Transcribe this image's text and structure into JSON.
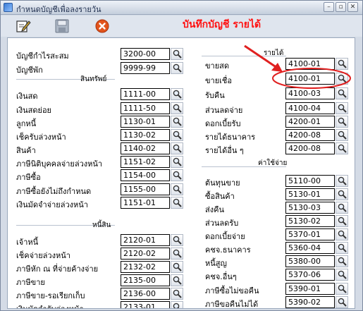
{
  "window": {
    "title": "กำหนดบัญชีเพื่อลงรายวัน"
  },
  "heading": "บันทึกบัญชี รายได้",
  "top_fields": [
    {
      "label": "บัญชีกำไรสะสม",
      "code": "3200-00"
    },
    {
      "label": "บัญชีพัก",
      "code": "9999-99"
    }
  ],
  "left_sections": [
    {
      "title": "สินทรัพย์",
      "rows": [
        {
          "label": "เงินสด",
          "code": "1111-00"
        },
        {
          "label": "เงินสดย่อย",
          "code": "1111-50"
        },
        {
          "label": "ลูกหนี้",
          "code": "1130-01"
        },
        {
          "label": "เช็ครับล่วงหน้า",
          "code": "1130-02"
        },
        {
          "label": "สินค้า",
          "code": "1140-02"
        },
        {
          "label": "ภาษีนิติบุคคลจ่ายล่วงหน้า",
          "code": "1151-02"
        },
        {
          "label": "ภาษีซื้อ",
          "code": "1154-00"
        },
        {
          "label": "ภาษีซื้อยังไม่ถึงกำหนด",
          "code": "1155-00"
        },
        {
          "label": "เงินมัดจำจ่ายล่วงหน้า",
          "code": "1151-01"
        }
      ]
    },
    {
      "title": "หนี้สิน",
      "rows": [
        {
          "label": "เจ้าหนี้",
          "code": "2120-01"
        },
        {
          "label": "เช็คจ่ายล่วงหน้า",
          "code": "2120-02"
        },
        {
          "label": "ภาษีหัก ณ ที่จ่ายค้างจ่าย",
          "code": "2132-02"
        },
        {
          "label": "ภาษีขาย",
          "code": "2135-00"
        },
        {
          "label": "ภาษีขาย-รอเรียกเก็บ",
          "code": "2136-00"
        },
        {
          "label": "เงินมัดจำรับล่วงหน้า",
          "code": "2133-01"
        }
      ]
    }
  ],
  "right_sections": [
    {
      "title": "รายได้",
      "rows": [
        {
          "label": "ขายสด",
          "code": "4100-01"
        },
        {
          "label": "ขายเชื่อ",
          "code": "4100-01"
        },
        {
          "label": "รับคืน",
          "code": "4100-03"
        },
        {
          "label": "ส่วนลดจ่าย",
          "code": "4100-04"
        },
        {
          "label": "ดอกเบี้ยรับ",
          "code": "4200-01"
        },
        {
          "label": "รายได้ธนาคาร",
          "code": "4200-08"
        },
        {
          "label": "รายได้อื่น ๆ",
          "code": "4200-08"
        }
      ]
    },
    {
      "title": "ค่าใช้จ่าย",
      "rows": [
        {
          "label": "ต้นทุนขาย",
          "code": "5110-00"
        },
        {
          "label": "ซื้อสินค้า",
          "code": "5130-01"
        },
        {
          "label": "ส่งคืน",
          "code": "5130-03"
        },
        {
          "label": "ส่วนลดรับ",
          "code": "5130-02"
        },
        {
          "label": "ดอกเบี้ยจ่าย",
          "code": "5370-01"
        },
        {
          "label": "คชจ.ธนาคาร",
          "code": "5360-04"
        },
        {
          "label": "หนี้สูญ",
          "code": "5380-00"
        },
        {
          "label": "คชจ.อื่นๆ",
          "code": "5370-06"
        },
        {
          "label": "ภาษีซื้อไม่ขอคืน",
          "code": "5390-01"
        },
        {
          "label": "ภาษีขอคืนไม่ได้",
          "code": "5390-02"
        }
      ]
    }
  ],
  "colors": {
    "heading": "#ff1111",
    "annotation": "#e02020"
  },
  "icons": {
    "edit": "edit-icon",
    "save": "save-icon",
    "cancel": "cancel-icon",
    "search": "search-icon"
  }
}
